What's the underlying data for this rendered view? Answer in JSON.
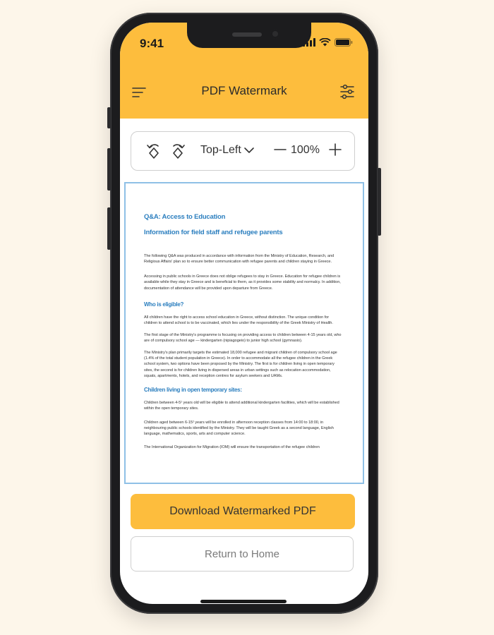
{
  "status_bar": {
    "time": "9:41"
  },
  "header": {
    "title": "PDF Watermark"
  },
  "toolbar": {
    "position": "Top-Left",
    "zoom": "100%"
  },
  "document": {
    "heading": "Q&A: Access to Education",
    "subheading": "Information for field staff and refugee parents",
    "para1": "The following Q&A was produced in accordance with information from the Ministry of Education, Research, and Religious Affairs' plan so to ensure better communication with refugee parents and children staying in Greece.",
    "para2": "Accessing in public schools in Greece does not oblige refugees to stay in Greece. Education for refugee children is available while they stay in Greece and is beneficial to them, as it provides some stability and normalcy. In addition, documentation of attendance will be provided upon departure from Greece.",
    "section1": "Who is eligible?",
    "para3": "All children have the right to access school education in Greece, without distinction. The unique condition for children to attend school is to be vaccinated, which lies under the responsibility of the Greek Ministry of Health.",
    "para4": "The first stage of the Ministry's programme is focusing on providing access to children between 4-15 years old, who are of compulsory school age — kindergarten (nipiagogeio) to junior high school (gymnasio).",
    "para5": "The Ministry's plan primarily targets the estimated 18,000 refugee and migrant children of compulsory school age (1.4% of the total student population in Greece). In order to accommodate all the refugee children in the Greek school system, two options have been proposed by the Ministry. The first is for children living in open temporary sites, the second is for children living in dispersed areas in urban settings such as relocation accommodation, squats, apartments, hotels, and reception centres for asylum seekers and UAMs.",
    "section2": "Children living in open temporary sites:",
    "para6": "Children between 4-5¹ years old will be eligible to attend additional kindergarten facilities, which will be established within the open temporary sites.",
    "para7": "Children aged between 6-15² years will be enrolled in afternoon reception classes from 14:00 to 18:00, in neighbouring public schools identified by the Ministry. They will be taught Greek as a second language, English language, mathematics, sports, arts and computer science.",
    "para8": "The International Organization for Migration (IOM) will ensure the transportation of the refugee children"
  },
  "actions": {
    "download": "Download Watermarked PDF",
    "home": "Return to Home"
  },
  "colors": {
    "accent": "#fdbd3d",
    "link_blue": "#2c7fbf",
    "background": "#fdf6ea"
  },
  "icons": [
    "menu-icon",
    "filter-settings-icon",
    "rotate-left-icon",
    "rotate-right-icon",
    "chevron-down-icon",
    "minus-icon",
    "plus-icon",
    "signal-icon",
    "wifi-icon",
    "battery-icon"
  ]
}
